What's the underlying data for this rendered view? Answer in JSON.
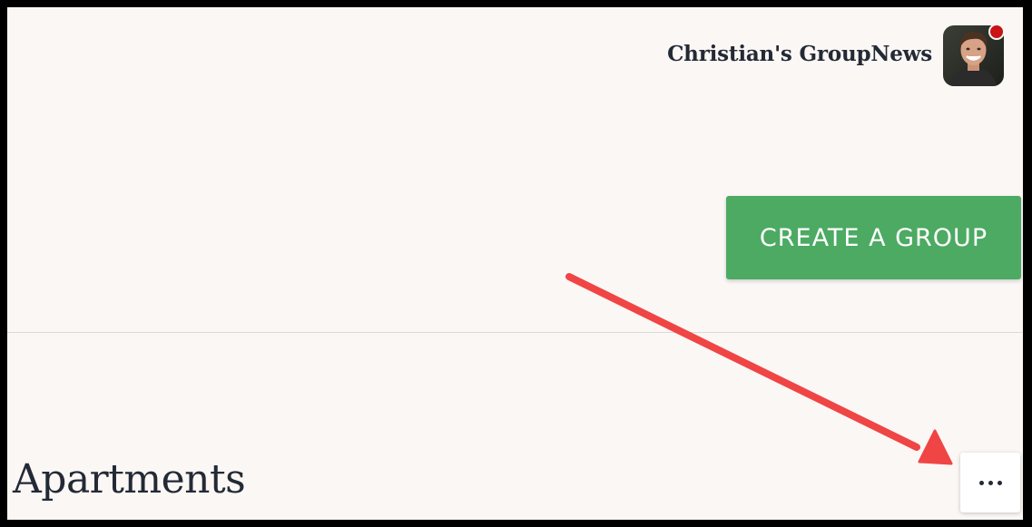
{
  "header": {
    "user_name": "Christian's GroupNews"
  },
  "actions": {
    "create_group_label": "CREATE A GROUP"
  },
  "section": {
    "title": "Apartments"
  },
  "icons": {
    "avatar": "user-avatar",
    "notification": "notification-dot-icon",
    "more": "more-horizontal-icon",
    "annotation": "red-arrow-annotation"
  },
  "colors": {
    "page_background": "#fbf7f5",
    "primary_button": "#4caa63",
    "text": "#232a35",
    "notification": "#c81414",
    "annotation_arrow": "#f04545"
  }
}
